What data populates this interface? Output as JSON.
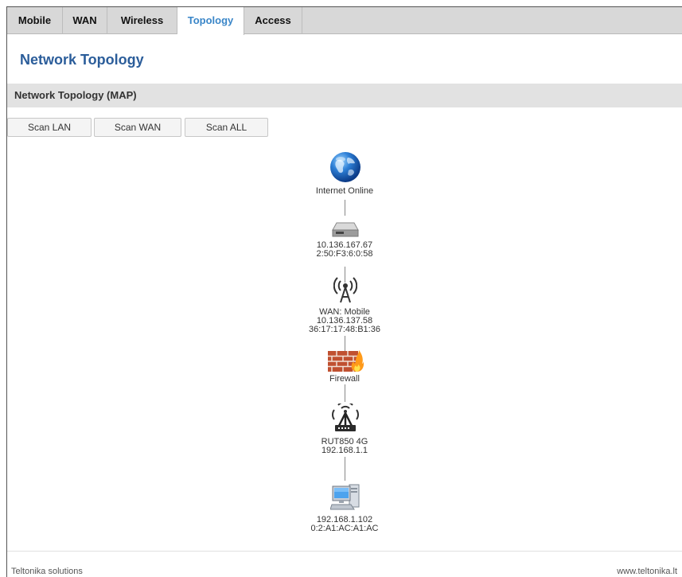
{
  "tabs": [
    {
      "label": "Mobile"
    },
    {
      "label": "WAN"
    },
    {
      "label": "Wireless"
    },
    {
      "label": "Topology",
      "active": true
    },
    {
      "label": "Access"
    }
  ],
  "page_title": "Network Topology",
  "section_title": "Network Topology (MAP)",
  "scan_buttons": {
    "lan": "Scan LAN",
    "wan": "Scan WAN",
    "all": "Scan ALL"
  },
  "topology": {
    "internet": {
      "icon": "globe-icon",
      "line1": "Internet Online"
    },
    "modem": {
      "icon": "modem-icon",
      "line1": "10.136.167.67",
      "line2": "2:50:F3:6:0:58"
    },
    "wan": {
      "icon": "antenna-icon",
      "line1": "WAN: Mobile",
      "line2": "10.136.137.58",
      "line3": "36:17:17:48:B1:36"
    },
    "firewall": {
      "icon": "firewall-icon",
      "line1": "Firewall"
    },
    "router": {
      "icon": "router-icon",
      "line1": "RUT850 4G",
      "line2": "192.168.1.1"
    },
    "client": {
      "icon": "computer-icon",
      "line1": "192.168.1.102",
      "line2": "0:2:A1:AC:A1:AC"
    }
  },
  "footer": {
    "left": "Teltonika solutions",
    "right": "www.teltonika.lt"
  },
  "colors": {
    "accent": "#3a86c8",
    "title": "#2b5d9a",
    "tabbar": "#d8d8d8"
  }
}
